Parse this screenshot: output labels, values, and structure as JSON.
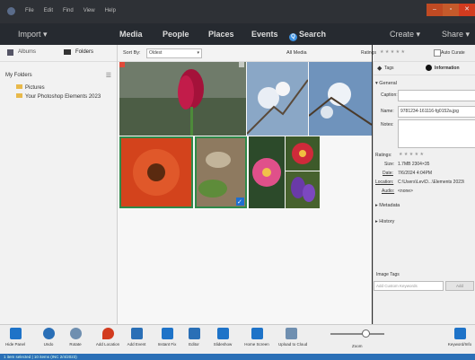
{
  "titlebar": {
    "menus": [
      "File",
      "Edit",
      "Find",
      "View",
      "Help"
    ],
    "window_controls": [
      "minimize",
      "restore",
      "close"
    ]
  },
  "navbar": {
    "import": "Import",
    "tabs": [
      "Media",
      "People",
      "Places",
      "Events"
    ],
    "active_tab": "Media",
    "search": "Search",
    "create": "Create",
    "share": "Share"
  },
  "left_panel": {
    "tab_albums": "Albums",
    "tab_folders": "Folders",
    "header": "My Folders",
    "folders": [
      "Pictures",
      "Your Photoshop Elements 2023"
    ]
  },
  "center_toolbar": {
    "sort_label": "Sort By:",
    "sort_value": "Oldest",
    "view_label": "All Media"
  },
  "right_panel": {
    "ratings_label": "Ratings",
    "auto_curate": "Auto Curate",
    "tab_tags": "Tags",
    "tab_information": "Information",
    "section_general": "General",
    "caption_label": "Caption:",
    "name_label": "Name:",
    "name_value": "9781234-161116-fg0152a.jpg",
    "notes_label": "Notes:",
    "ratings_row_label": "Ratings:",
    "size_label": "Size:",
    "size_value": "1.7MB 2304×35",
    "date_label": "Date:",
    "date_value": "7/6/2024 4:04PM",
    "location_label": "Location:",
    "location_value": "C:\\Users\\Lev\\D...\\Elements 2023\\",
    "audio_label": "Audio:",
    "audio_value": "<none>",
    "section_metadata": "Metadata",
    "section_history": "History",
    "image_tags_label": "Image Tags",
    "add_keywords_placeholder": "Add Custom Keywords",
    "add_button": "Add"
  },
  "bottom_toolbar": {
    "items": [
      "Hide Panel",
      "Undo",
      "Rotate",
      "Add Location",
      "Add Event",
      "Instant Fix",
      "Editor",
      "Slideshow",
      "Home Screen",
      "Upload to Cloud"
    ],
    "zoom_label": "Zoom",
    "keyword_label": "Keyword/Info"
  },
  "statusbar": {
    "text": "1 item selected | 10 items  (INC 2/4/2023)"
  }
}
